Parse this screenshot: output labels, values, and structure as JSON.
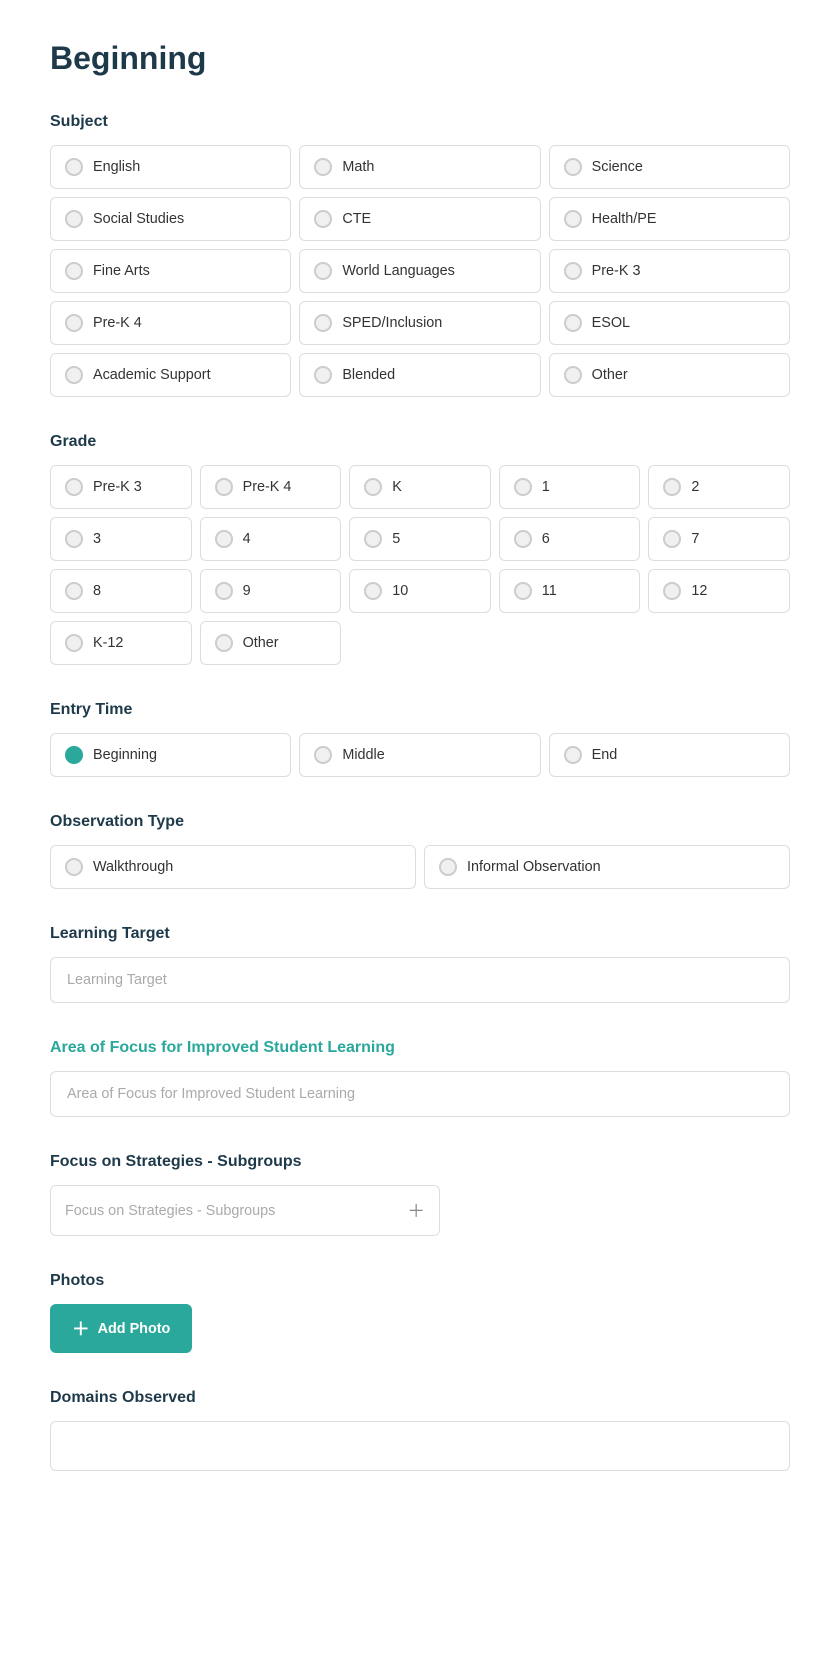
{
  "page": {
    "title": "Beginning"
  },
  "subject": {
    "label": "Subject",
    "options": [
      "English",
      "Math",
      "Science",
      "Social Studies",
      "CTE",
      "Health/PE",
      "Fine Arts",
      "World Languages",
      "Pre-K 3",
      "Pre-K 4",
      "SPED/Inclusion",
      "ESOL",
      "Academic Support",
      "Blended",
      "Other"
    ]
  },
  "grade": {
    "label": "Grade",
    "options": [
      "Pre-K 3",
      "Pre-K 4",
      "K",
      "1",
      "2",
      "3",
      "4",
      "5",
      "6",
      "7",
      "8",
      "9",
      "10",
      "11",
      "12",
      "K-12",
      "Other"
    ]
  },
  "entry_time": {
    "label": "Entry Time",
    "options": [
      "Beginning",
      "Middle",
      "End"
    ]
  },
  "observation_type": {
    "label": "Observation Type",
    "options": [
      "Walkthrough",
      "Informal Observation"
    ]
  },
  "learning_target": {
    "label": "Learning Target",
    "placeholder": "Learning Target"
  },
  "area_of_focus": {
    "label": "Area of Focus for Improved Student Learning",
    "placeholder": "Area of Focus for Improved Student Learning"
  },
  "focus_strategies": {
    "label": "Focus on Strategies - Subgroups",
    "placeholder": "Focus on Strategies - Subgroups"
  },
  "photos": {
    "label": "Photos",
    "add_button": "Add Photo"
  },
  "domains": {
    "label": "Domains Observed"
  }
}
